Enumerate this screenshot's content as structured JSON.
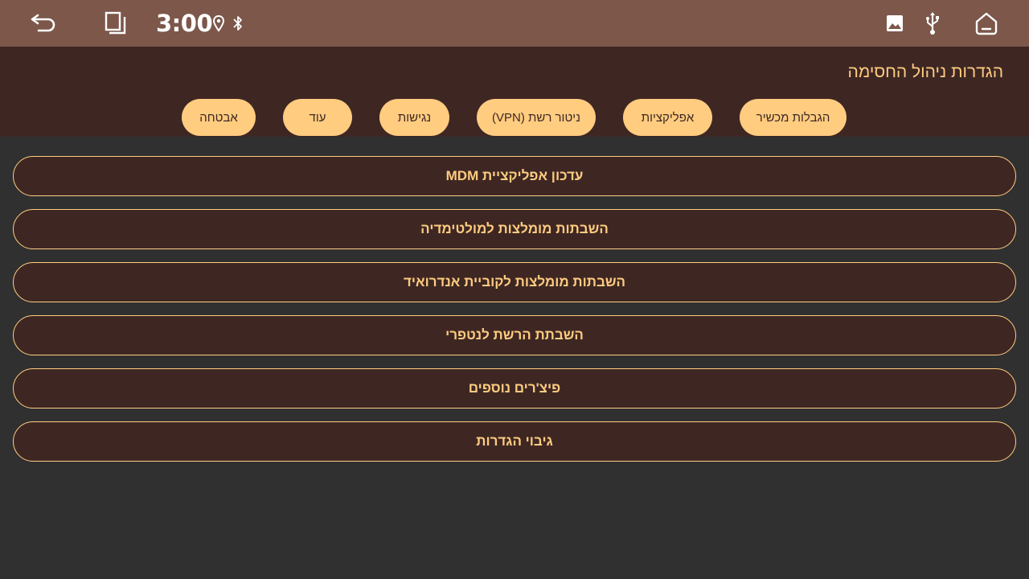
{
  "status_bar": {
    "time": "3:00",
    "icons": [
      "back-arrow-icon",
      "recents-icon",
      "location-pin-icon",
      "bluetooth-icon",
      "image-icon",
      "usb-icon",
      "home-icon"
    ]
  },
  "header": {
    "title": "הגדרות ניהול החסימה"
  },
  "tabs": [
    {
      "label": "הגבלות מכשיר"
    },
    {
      "label": "אפליקציות"
    },
    {
      "label": "ניטור רשת (VPN)"
    },
    {
      "label": "נגישות"
    },
    {
      "label": "עוד"
    },
    {
      "label": "אבטחה"
    }
  ],
  "menu": [
    {
      "label": "עדכון אפליקציית MDM"
    },
    {
      "label": "השבתות מומלצות למולטימדיה"
    },
    {
      "label": "השבתות מומלצות לקוביית אנדרואיד"
    },
    {
      "label": "השבתת הרשת לנטפרי"
    },
    {
      "label": "פיצ'רים נוספים"
    },
    {
      "label": "גיבוי הגדרות"
    }
  ],
  "colors": {
    "status_bar": "#7c574a",
    "header_bg": "#3e2723",
    "accent": "#ffcc80",
    "background": "#303030"
  }
}
